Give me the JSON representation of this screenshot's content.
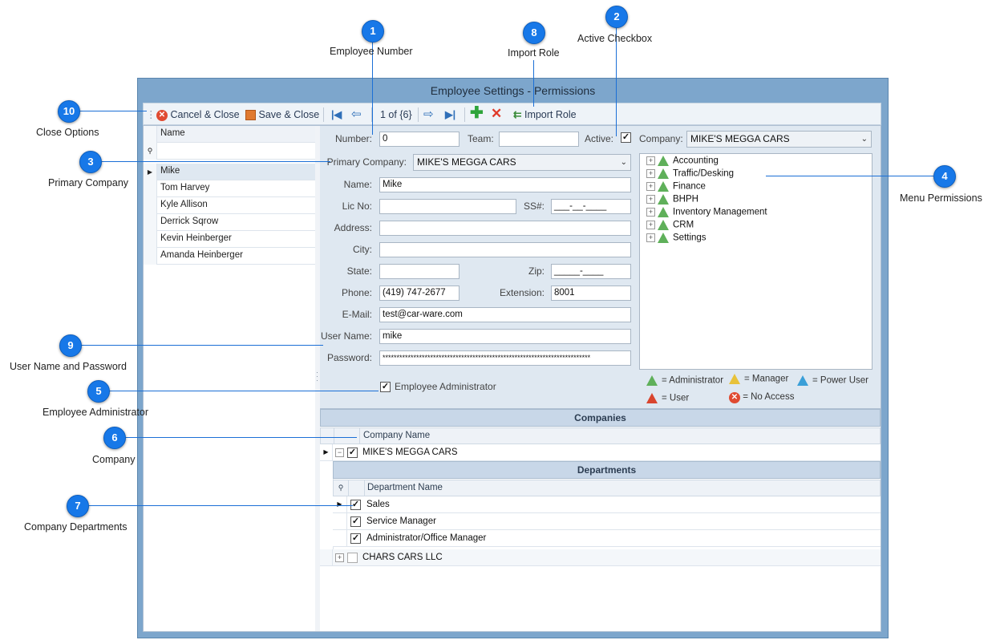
{
  "window": {
    "title": "Employee Settings - Permissions"
  },
  "toolbar": {
    "cancel_close": "Cancel & Close",
    "save_close": "Save & Close",
    "record_position": "1 of {6}",
    "import_role": "Import Role"
  },
  "employee_list": {
    "column_header": "Name",
    "rows": [
      "Mike",
      "Tom Harvey",
      "Kyle Allison",
      "Derrick Sqrow",
      "Kevin Heinberger",
      "Amanda Heinberger"
    ]
  },
  "form": {
    "number_label": "Number:",
    "number_value": "0",
    "team_label": "Team:",
    "team_value": "",
    "active_label": "Active:",
    "company_label": "Company:",
    "company_value": "MIKE'S MEGGA CARS",
    "primary_company_label": "Primary Company:",
    "primary_company_value": "MIKE'S MEGGA CARS",
    "name_label": "Name:",
    "name_value": "Mike",
    "lic_label": "Lic No:",
    "lic_value": "",
    "ssn_label": "SS#:",
    "ssn_value": "___-__-____",
    "address_label": "Address:",
    "address_value": "",
    "city_label": "City:",
    "city_value": "",
    "state_label": "State:",
    "state_value": "",
    "zip_label": "Zip:",
    "zip_value": "_____-____",
    "phone_label": "Phone:",
    "phone_value": "(419) 747-2677",
    "extension_label": "Extension:",
    "extension_value": "8001",
    "email_label": "E-Mail:",
    "email_value": "test@car-ware.com",
    "username_label": "User Name:",
    "username_value": "mike",
    "password_label": "Password:",
    "password_value": "**************************************************************************",
    "employee_admin_label": "Employee Administrator"
  },
  "menu_permissions": {
    "items": [
      "Accounting",
      "Traffic/Desking",
      "Finance",
      "BHPH",
      "Inventory Management",
      "CRM",
      "Settings"
    ]
  },
  "legend": {
    "administrator": "= Administrator",
    "manager": "= Manager",
    "power_user": "= Power User",
    "user": "= User",
    "no_access": "= No Access"
  },
  "companies": {
    "header": "Companies",
    "column_header": "Company Name",
    "rows": [
      "MIKE'S MEGGA CARS",
      "CHARS CARS LLC"
    ]
  },
  "departments": {
    "header": "Departments",
    "column_header": "Department Name",
    "rows": [
      "Sales",
      "Service Manager",
      "Administrator/Office Manager"
    ]
  },
  "callouts": {
    "c1": {
      "num": "1",
      "label": "Employee Number"
    },
    "c2": {
      "num": "2",
      "label": "Active Checkbox"
    },
    "c3": {
      "num": "3",
      "label": "Primary Company"
    },
    "c4": {
      "num": "4",
      "label": "Menu Permissions"
    },
    "c5": {
      "num": "5",
      "label": "Employee Administrator"
    },
    "c6": {
      "num": "6",
      "label": "Company"
    },
    "c7": {
      "num": "7",
      "label": "Company Departments"
    },
    "c8": {
      "num": "8",
      "label": "Import Role"
    },
    "c9": {
      "num": "9",
      "label": "User Name and Password"
    },
    "c10": {
      "num": "10",
      "label": "Close Options"
    }
  },
  "colors": {
    "accent": "#1778e8",
    "window_frame": "#7da6cc",
    "form_bg": "#dfe8f1"
  }
}
